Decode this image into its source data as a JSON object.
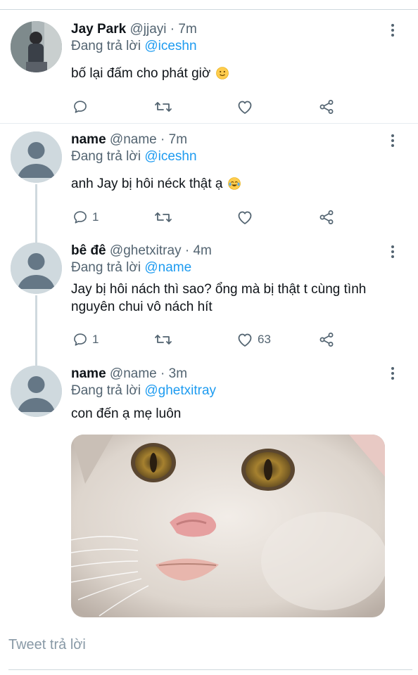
{
  "tweets": [
    {
      "name": "Jay Park",
      "handle": "@jjayi",
      "sep": "·",
      "time": "7m",
      "reply_prefix": "Đang trả lời",
      "reply_to": "@iceshn",
      "text": "bố lại đấm cho phát giờ",
      "emoji_icon": "slightly-smiling-face-icon",
      "reply_count": "",
      "retweet_count": "",
      "like_count": ""
    },
    {
      "name": "name",
      "handle": "@name",
      "sep": "·",
      "time": "7m",
      "reply_prefix": "Đang trả lời",
      "reply_to": "@iceshn",
      "text": "anh Jay bị hôi néck thật ạ",
      "emoji_icon": "face-with-tears-of-joy-icon",
      "reply_count": "1",
      "retweet_count": "",
      "like_count": ""
    },
    {
      "name": "bê đê",
      "handle": "@ghetxitray",
      "sep": "·",
      "time": "4m",
      "reply_prefix": "Đang trả lời",
      "reply_to": "@name",
      "text": "Jay bị hôi nách thì sao? ổng mà bị thật t cùng tình nguyên chui vô nách hít",
      "reply_count": "1",
      "retweet_count": "",
      "like_count": "63"
    },
    {
      "name": "name",
      "handle": "@name",
      "sep": "·",
      "time": "3m",
      "reply_prefix": "Đang trả lời",
      "reply_to": "@ghetxitray",
      "text": "con đến ạ mẹ luôn",
      "media": "cat-photo"
    }
  ],
  "reply_box": {
    "placeholder": "Tweet trả lời"
  },
  "colors": {
    "accent": "#1d9bf0",
    "secondary_text": "#536471",
    "divider": "#e6ecf0"
  },
  "icons": {
    "reply": "comment-bubble-icon",
    "retweet": "retweet-icon",
    "like": "heart-icon",
    "share": "share-icon",
    "more": "vertical-dots-icon"
  }
}
